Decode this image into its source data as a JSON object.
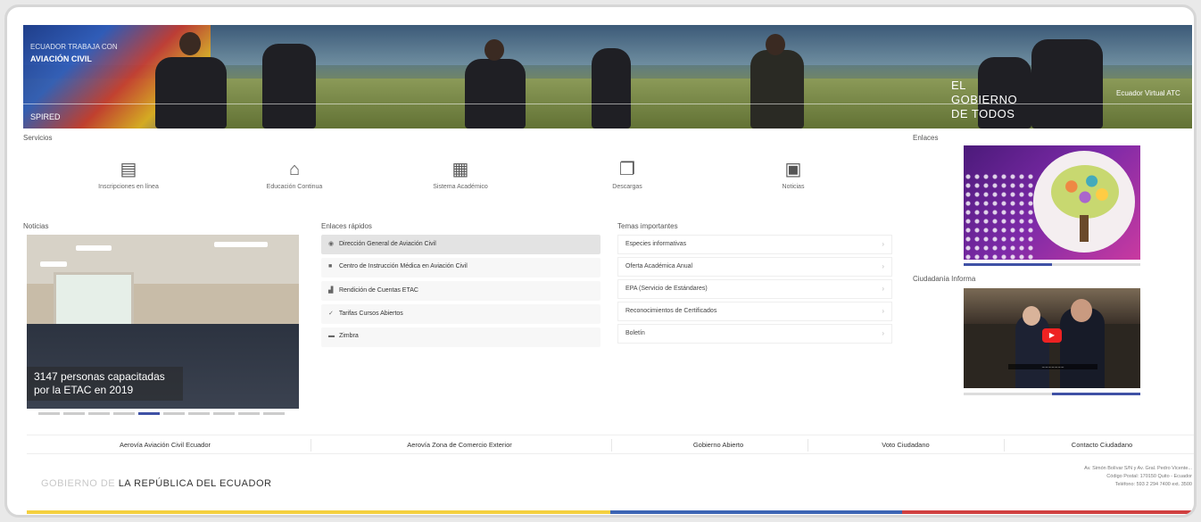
{
  "banner": {
    "tagline": "ECUADOR TRABAJA CON",
    "tagline_bold": "AVIACIÓN CIVIL",
    "bottom_left": "SPIRED",
    "gov_lines": [
      "EL",
      "GOBIERNO",
      "DE TODOS"
    ],
    "right_tag": "Ecuador Virtual ATC"
  },
  "services": {
    "label": "Servicios",
    "items": [
      {
        "label": "Inscripciones en línea",
        "icon": "edit-document-icon"
      },
      {
        "label": "Educación Continua",
        "icon": "graduation-cap-icon"
      },
      {
        "label": "Sistema Académico",
        "icon": "spreadsheet-icon"
      },
      {
        "label": "Descargas",
        "icon": "documents-icon"
      },
      {
        "label": "Noticias",
        "icon": "newspaper-icon"
      }
    ]
  },
  "news": {
    "label": "Noticias",
    "caption": "3147 personas capacitadas por la ETAC en 2019",
    "slide_count": 10,
    "active_slide": 5
  },
  "quick_links": {
    "label": "Enlaces rápidos",
    "items": [
      {
        "label": "Dirección General de Aviación Civil",
        "icon": "globe-icon",
        "active": true
      },
      {
        "label": "Centro de Instrucción Médica en Aviación Civil",
        "icon": "lock-icon",
        "active": false
      },
      {
        "label": "Rendición de Cuentas ETAC",
        "icon": "chart-icon",
        "active": false
      },
      {
        "label": "Tarifas Cursos Abiertos",
        "icon": "check-icon",
        "active": false
      },
      {
        "label": "Zimbra",
        "icon": "briefcase-icon",
        "active": false
      }
    ]
  },
  "topics": {
    "label": "Temas importantes",
    "items": [
      {
        "label": "Especies informativas"
      },
      {
        "label": "Oferta Académica Anual"
      },
      {
        "label": "EPA (Servicio de Estándares)"
      },
      {
        "label": "Reconocimientos de Certificados"
      },
      {
        "label": "Boletín"
      }
    ]
  },
  "links": {
    "label": "Enlaces",
    "progress": 0.5
  },
  "video": {
    "label": "Ciudadanía Informa",
    "caption_text": "..................",
    "progress": 0.5
  },
  "bottom_nav": {
    "items": [
      "Aerovía Aviación Civil Ecuador",
      "Aerovía Zona de Comercio Exterior",
      "Gobierno Abierto",
      "Voto Ciudadano",
      "Contacto Ciudadano"
    ]
  },
  "footer": {
    "brand_light": "GOBIERNO DE",
    "brand_dark": "LA REPÚBLICA DEL ECUADOR",
    "address_lines": [
      "Av. Simón Bolívar S/N y Av. Gral. Pedro Vicente...",
      "Código Postal: 170150 Quito - Ecuador",
      "Teléfono: 593 2 294 7400 ext. 3500"
    ]
  },
  "colors": {
    "accent": "#3f51a5",
    "flag_yellow": "#f4d03f",
    "flag_blue": "#3c64b4",
    "flag_red": "#d04040"
  }
}
